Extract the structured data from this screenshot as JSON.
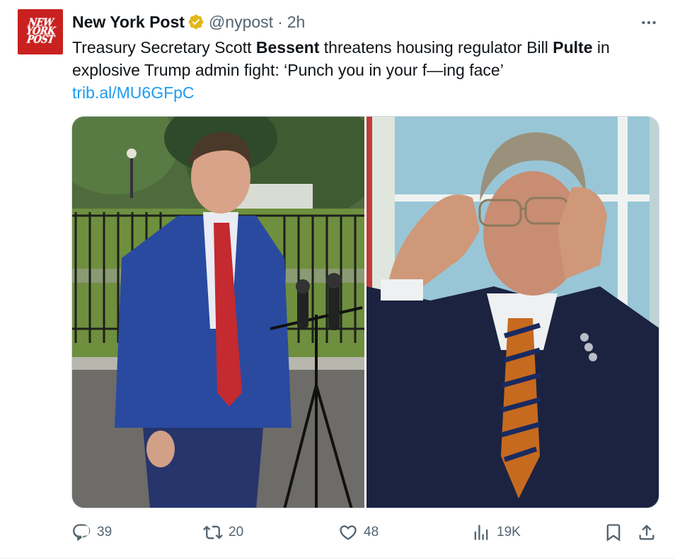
{
  "tweet": {
    "author_name": "New York Post",
    "handle": "@nypost",
    "separator": "·",
    "time": "2h",
    "avatar_text": [
      "NEW",
      "YORK",
      "POST"
    ],
    "text_segments": [
      {
        "text": "Treasury Secretary Scott ",
        "bold": false
      },
      {
        "text": "Bessent",
        "bold": true
      },
      {
        "text": " threatens housing regulator Bill ",
        "bold": false
      },
      {
        "text": "Pulte",
        "bold": true
      },
      {
        "text": " in explosive Trump admin fight: ‘Punch you in your f—ing face’",
        "bold": false
      }
    ],
    "link": "trib.al/MU6GFpC"
  },
  "actions": {
    "replies": "39",
    "reposts": "20",
    "likes": "48",
    "views": "19K"
  },
  "icons": {
    "verified": "gold-verified-badge-icon",
    "more": "more-options-icon",
    "reply": "reply-icon",
    "repost": "repost-icon",
    "like": "heart-icon",
    "views": "views-icon",
    "bookmark": "bookmark-icon",
    "share": "share-icon"
  },
  "colors": {
    "avatar_bg": "#c8211f",
    "link": "#1d9bf0",
    "secondary_text": "#536471",
    "verified_gold": "#e2b719"
  }
}
